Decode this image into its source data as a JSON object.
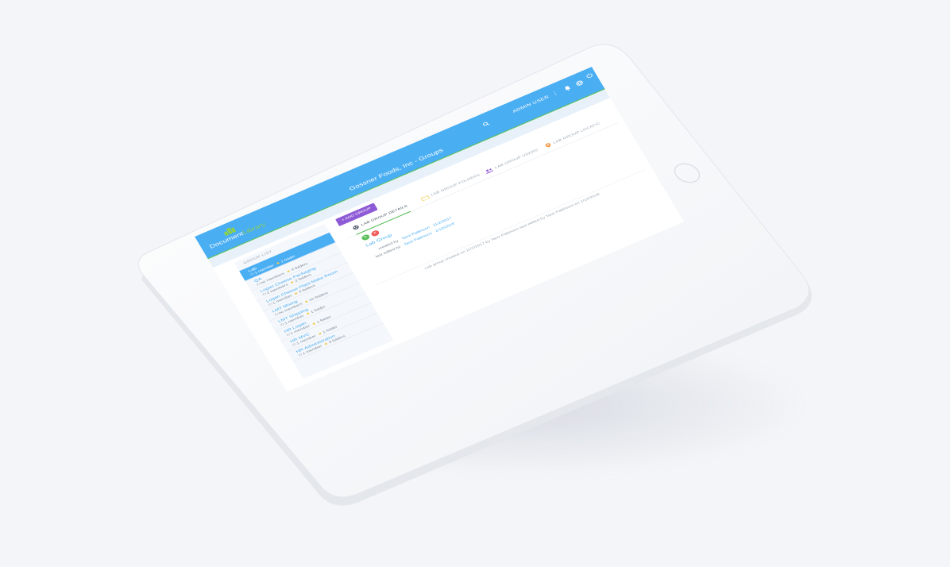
{
  "app": {
    "logo_word1": "Document",
    "logo_word2": "Library",
    "title": "Gossner Foods, Inc - Groups",
    "user_label": "ADMIN USER",
    "icons": [
      "search-icon",
      "kebab-icon",
      "bell-icon",
      "globe-icon",
      "power-icon"
    ]
  },
  "sidebar": {
    "heading": "GROUP LIST",
    "groups": [
      {
        "name": "Lab",
        "members": "1 member",
        "folders": "1 folder",
        "active": true
      },
      {
        "name": "QA",
        "members": "no members",
        "folders": "4 folders"
      },
      {
        "name": "Logan Cheese Packaging",
        "members": "2 members",
        "folders": "2 folders"
      },
      {
        "name": "Logan Cheese Plant Make Room",
        "members": "1 member",
        "folders": "4 folders"
      },
      {
        "name": "LMT Mixing",
        "members": "no members",
        "folders": "no folders"
      },
      {
        "name": "LMT Shipping",
        "members": "1 member",
        "folders": "1 folder"
      },
      {
        "name": "HR Logan",
        "members": "1 member",
        "folders": "1 folder"
      },
      {
        "name": "HR MVC",
        "members": "1 member",
        "folders": "1 folder"
      },
      {
        "name": "HR Administration",
        "members": "1 member",
        "folders": "3 folders"
      }
    ]
  },
  "main": {
    "add_group_label": "+ ADD GROUP",
    "tabs": [
      {
        "label": "LAB GROUP DETAILS",
        "active": true
      },
      {
        "label": "LAB GROUP FOLDERS"
      },
      {
        "label": "LAB GROUP USERS"
      },
      {
        "label": "LAB GROUP LOCATIC"
      }
    ],
    "details": {
      "name": "Lab Group",
      "created_by_label": "created by",
      "created_by": "Tami Pattinson",
      "created_on": "11/2/2017",
      "edited_by_label": "last edited by",
      "edited_by": "Tami Pattinson",
      "edited_on": "1/10/2018"
    },
    "footer": "Lab group created on 11/2/2017 by Tami Pattinson last edited by Tami Pattinson on 1/10/2018"
  },
  "colors": {
    "primary": "#4aaef3",
    "accent_green": "#5cc05c",
    "purple": "#8e5bd6",
    "danger": "#ef5a5a",
    "bezel": "#ffffff",
    "background": "#f3f5f8"
  }
}
